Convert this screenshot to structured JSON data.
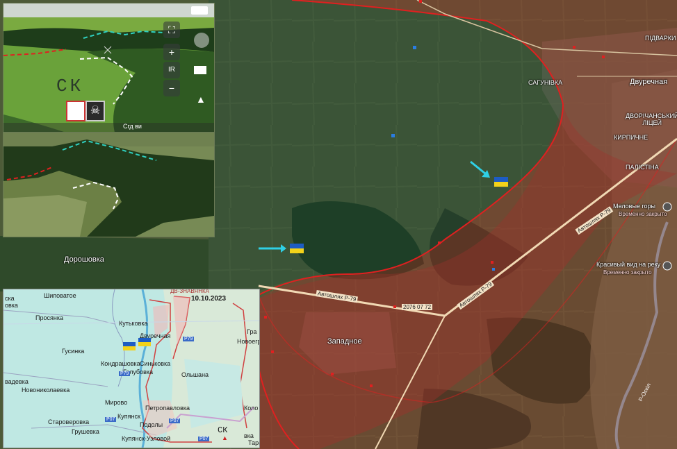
{
  "map": {
    "villages": {
      "podvarki": "ПІДВАРКИ",
      "sagunivka": "САГУНІВКА",
      "dvurechnaya": "Двуречная",
      "licej": "ДВОРІЧАНСЬКИЙ\nЛІЦЕЙ",
      "kirpichne": "КИРПИЧНЕ",
      "palestina": "ПАЛІСТІНА",
      "meloviye": "Меловые горы",
      "meloviye_sub": "Временно закрыто",
      "krasiviy": "Красивый вид на реку",
      "krasiviy_sub": "Временно закрыто",
      "doroshovka": "Дорошовка",
      "zapadnoe": "Западное"
    },
    "roads": {
      "p79_a": "Автошлях Р-79",
      "p79_b": "Автошлях Р-79",
      "p79_c": "Автошлях Р-79",
      "road_num": "2076 07 72",
      "p_label": "Р-Оскіл"
    },
    "colors": {
      "occupied": "#a0322b",
      "frontline": "#e02020",
      "ua_blue": "#1d5cc4",
      "ua_yellow": "#f3d21a",
      "arrow": "#2fd0e6"
    }
  },
  "drone": {
    "overlay_text": "СК",
    "hud_buttons": [
      "+",
      "IR",
      "−"
    ],
    "bottom_text": "Сгд ви"
  },
  "inset": {
    "date": "10.10.2023",
    "towns": {
      "shipovatoe": "Шиповатое",
      "prosyanka": "Просянка",
      "kutkovka": "Кутьковка",
      "dvurechnaya": "Двуречная",
      "gusinka": "Гусинка",
      "novoe": "Новоегр",
      "olshana": "Ольшана",
      "sinkovka": "Синьковка",
      "kondrashovka": "Кондрашовка",
      "golubovka": "Голубовка",
      "mirovoe": "Мирово",
      "petropavlovka": "Петропавловка",
      "kupyansk": "Купянск",
      "podoly": "Подолы",
      "staroverovka": "Староверовка",
      "grushevka": "Грушевка",
      "kupyansk_uzlovoy": "Купянск-Узловой",
      "novonikolaevka": "Новониколаевка",
      "vadevka": "вадевка",
      "tara": "Тара",
      "gra": "Гра",
      "dp": "ДВ-ЗНАВЯНКА",
      "kolo": "Коло",
      "ska": "ска",
      "ovka": "овка",
      "ivka": "вка"
    },
    "road_badges": [
      "Р79",
      "Р79",
      "Р07",
      "Р07",
      "Р07"
    ],
    "marker": "СК"
  }
}
